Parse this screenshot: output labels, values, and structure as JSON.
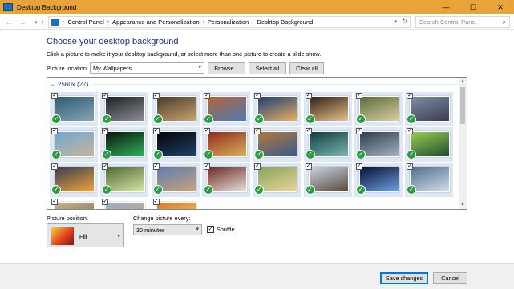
{
  "window": {
    "title": "Desktop Background",
    "controls": {
      "minimize": "—",
      "maximize": "☐",
      "close": "✕"
    }
  },
  "address": {
    "back": "←",
    "forward": "→",
    "up": "↑",
    "breadcrumb": [
      "Control Panel",
      "Appearance and Personalization",
      "Personalization",
      "Desktop Background"
    ],
    "separator": "›",
    "search_placeholder": "Search Control Panel"
  },
  "content": {
    "heading": "Choose your desktop background",
    "instructions": "Click a picture to make it your desktop background, or select more than one picture to create a slide show.",
    "picture_location_label": "Picture location:",
    "picture_location_value": "My Wallpapers",
    "browse_label": "Browse...",
    "select_all_label": "Select all",
    "clear_all_label": "Clear all"
  },
  "gallery": {
    "group_label": "2560x (27)",
    "columns": 8,
    "tiles": [
      {
        "colors": [
          "#2f5a73",
          "#86a5b3"
        ],
        "selected": true
      },
      {
        "colors": [
          "#1d1f22",
          "#8a8f95"
        ],
        "selected": true
      },
      {
        "colors": [
          "#4a3a2b",
          "#c9a46a"
        ],
        "selected": true
      },
      {
        "colors": [
          "#b3643a",
          "#4e7bb5"
        ],
        "selected": true
      },
      {
        "colors": [
          "#1e3c7a",
          "#e6b15e"
        ],
        "selected": true
      },
      {
        "colors": [
          "#2e1e14",
          "#e8c28a"
        ],
        "selected": true
      },
      {
        "colors": [
          "#5b6a3a",
          "#d8cf9f"
        ],
        "selected": true
      },
      {
        "colors": [
          "#7b8fa5",
          "#3d3a52"
        ],
        "selected": true
      },
      {
        "colors": [
          "#6fa7d4",
          "#c6b79a"
        ],
        "selected": true
      },
      {
        "colors": [
          "#06140a",
          "#2fb35e"
        ],
        "selected": true
      },
      {
        "colors": [
          "#050505",
          "#1f3f6e"
        ],
        "selected": true
      },
      {
        "colors": [
          "#8e2a1c",
          "#d9b25a"
        ],
        "selected": true
      },
      {
        "colors": [
          "#b07a3c",
          "#3a5a8c"
        ],
        "selected": true
      },
      {
        "colors": [
          "#0f3b3e",
          "#7bb7b0"
        ],
        "selected": true
      },
      {
        "colors": [
          "#2b3b4a",
          "#a4b3c1"
        ],
        "selected": true
      },
      {
        "colors": [
          "#9ccf57",
          "#1e4d2b"
        ],
        "selected": true
      },
      {
        "colors": [
          "#3a3e52",
          "#f2a43a"
        ],
        "selected": true
      },
      {
        "colors": [
          "#4f6a2e",
          "#d8e6a8"
        ],
        "selected": true
      },
      {
        "colors": [
          "#5d7fb0",
          "#c9a17a"
        ],
        "selected": true
      },
      {
        "colors": [
          "#6e2a22",
          "#e5e0da"
        ],
        "selected": true
      },
      {
        "colors": [
          "#8aa45a",
          "#e8d59a"
        ],
        "selected": true
      },
      {
        "colors": [
          "#c7d3e3",
          "#5a4a3a"
        ],
        "selected": true
      },
      {
        "colors": [
          "#061030",
          "#6ea0e8"
        ],
        "selected": true
      },
      {
        "colors": [
          "#4f6f8f",
          "#d2dde8"
        ],
        "selected": true
      },
      {
        "colors": [
          "#c4b28e",
          "#7a6a4e"
        ],
        "selected": false
      },
      {
        "colors": [
          "#9bb0c8",
          "#d0a07a"
        ],
        "selected": false
      },
      {
        "colors": [
          "#d87a2a",
          "#f4d27a"
        ],
        "selected": false
      }
    ]
  },
  "options": {
    "picture_position_label": "Picture position:",
    "picture_position_value": "Fill",
    "change_every_label": "Change picture every:",
    "change_every_value": "30 minutes",
    "shuffle_label": "Shuffle",
    "shuffle_checked": true
  },
  "footer": {
    "save_label": "Save changes",
    "cancel_label": "Cancel"
  }
}
